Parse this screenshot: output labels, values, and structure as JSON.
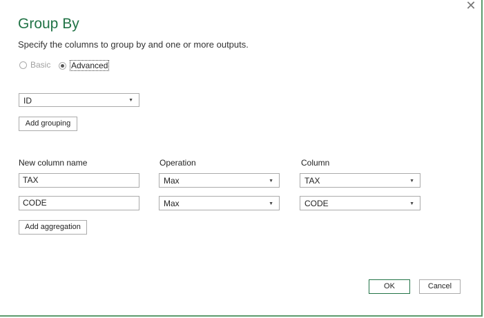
{
  "dialog": {
    "title": "Group By",
    "subtitle": "Specify the columns to group by and one or more outputs.",
    "close_glyph": "✕"
  },
  "mode": {
    "basic_label": "Basic",
    "advanced_label": "Advanced",
    "selected": "Advanced"
  },
  "grouping": {
    "selected_column": "ID",
    "add_grouping_label": "Add grouping"
  },
  "aggregation": {
    "headers": {
      "new_column_name": "New column name",
      "operation": "Operation",
      "column": "Column"
    },
    "rows": [
      {
        "name": "TAX",
        "operation": "Max",
        "column": "TAX"
      },
      {
        "name": "CODE",
        "operation": "Max",
        "column": "CODE"
      }
    ],
    "add_aggregation_label": "Add aggregation"
  },
  "footer": {
    "ok_label": "OK",
    "cancel_label": "Cancel"
  },
  "icons": {
    "dropdown_arrow": "▼"
  },
  "colors": {
    "accent": "#217346",
    "border": "#5b9a6b"
  }
}
